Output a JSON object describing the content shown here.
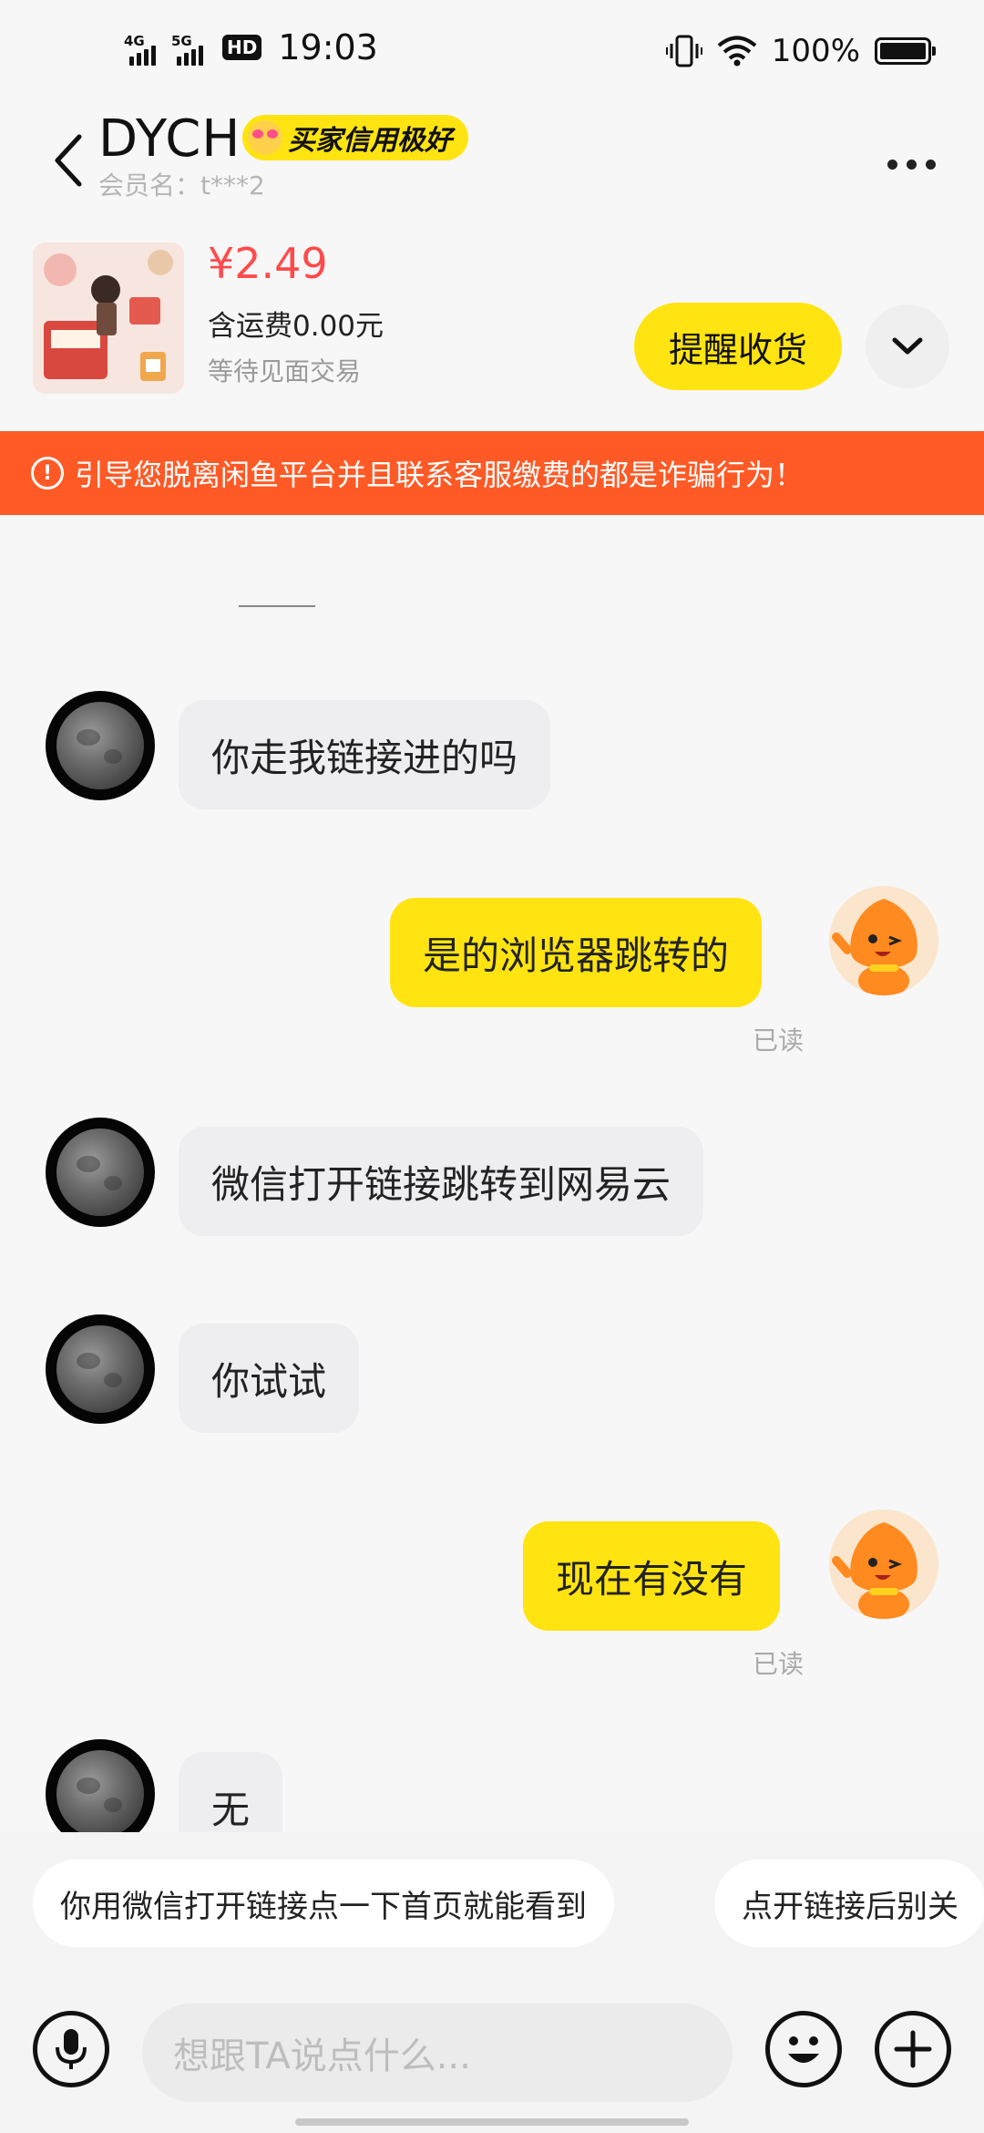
{
  "status_bar": {
    "net1": "4G",
    "net2": "5G",
    "hd": "HD",
    "time": "19:03",
    "battery_pct": "100%"
  },
  "header": {
    "title": "DYCH",
    "badge": "买家信用极好",
    "member": "会员名：t***2"
  },
  "product": {
    "price": "¥2.49",
    "shipping": "含运费0.00元",
    "status": "等待见面交易",
    "remind_label": "提醒收货"
  },
  "warning": {
    "text": "引导您脱离闲鱼平台并且联系客服缴费的都是诈骗行为！"
  },
  "messages": [
    {
      "side": "in",
      "text": "你走我链接进的吗"
    },
    {
      "side": "out",
      "text": "是的浏览器跳转的",
      "read": "已读"
    },
    {
      "side": "in",
      "text": "微信打开链接跳转到网易云"
    },
    {
      "side": "in",
      "text": "你试试"
    },
    {
      "side": "out",
      "text": "现在有没有",
      "read": "已读"
    },
    {
      "side": "in",
      "text": "无"
    }
  ],
  "quick_replies": [
    "你用微信打开链接点一下首页就能看到",
    "点开链接后别关"
  ],
  "input": {
    "placeholder": "想跟TA说点什么..."
  },
  "colors": {
    "accent": "#ffe411",
    "price": "#ff4b4b",
    "warning": "#ff5a26"
  }
}
